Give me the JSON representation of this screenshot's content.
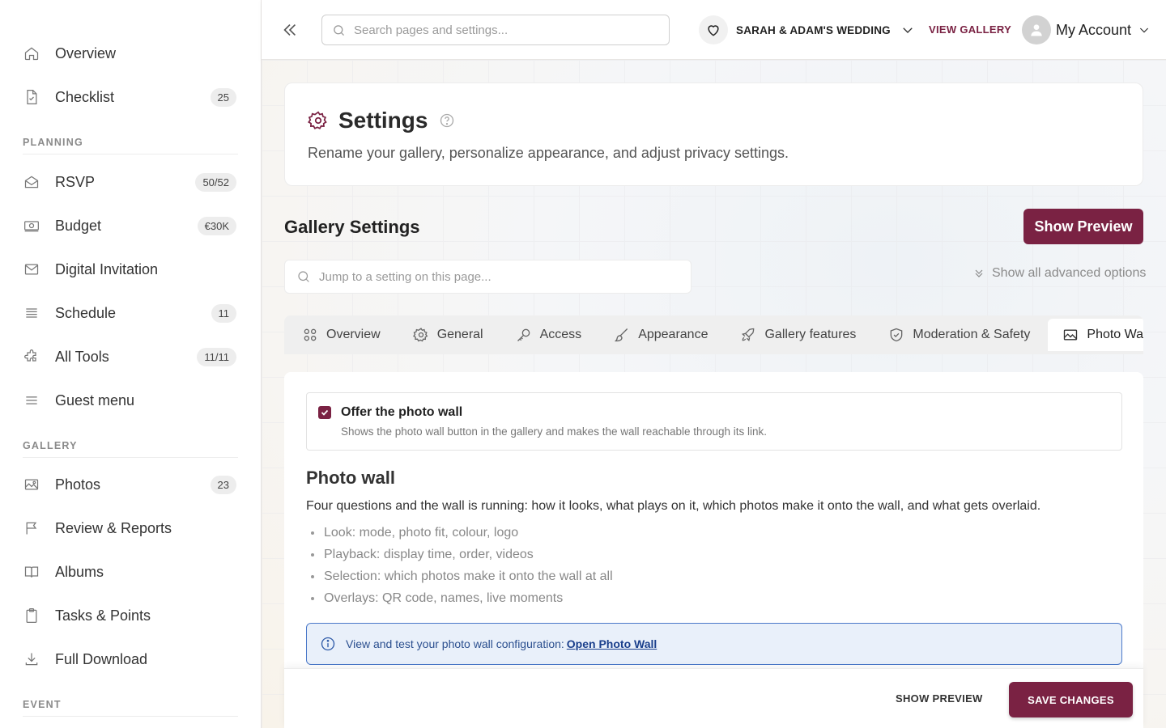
{
  "sidebar": {
    "items": [
      {
        "label": "Overview",
        "icon": "home-icon"
      },
      {
        "label": "Checklist",
        "icon": "checklist-icon",
        "badge": "25"
      },
      {
        "label": "RSVP",
        "icon": "envelope-open-icon",
        "badge": "50/52"
      },
      {
        "label": "Budget",
        "icon": "money-icon",
        "badge": "€30K"
      },
      {
        "label": "Digital Invitation",
        "icon": "mail-icon"
      },
      {
        "label": "Schedule",
        "icon": "list-icon",
        "badge": "11"
      },
      {
        "label": "All Tools",
        "icon": "puzzle-icon",
        "badge": "11/11"
      },
      {
        "label": "Guest menu",
        "icon": "menu-icon"
      },
      {
        "label": "Photos",
        "icon": "image-icon",
        "badge": "23"
      },
      {
        "label": "Review & Reports",
        "icon": "flag-icon"
      },
      {
        "label": "Albums",
        "icon": "book-icon"
      },
      {
        "label": "Tasks & Points",
        "icon": "clipboard-icon"
      },
      {
        "label": "Full Download",
        "icon": "download-icon"
      }
    ],
    "sections": {
      "planning": "PLANNING",
      "gallery": "GALLERY",
      "event": "EVENT"
    }
  },
  "topbar": {
    "search_placeholder": "Search pages and settings...",
    "event_name": "SARAH & ADAM'S WEDDING",
    "view_gallery": "VIEW GALLERY",
    "account_label": "My Account"
  },
  "header": {
    "title": "Settings",
    "subtitle": "Rename your gallery, personalize appearance, and adjust privacy settings."
  },
  "gallery_settings": {
    "title": "Gallery Settings",
    "show_preview": "Show Preview",
    "jump_placeholder": "Jump to a setting on this page...",
    "advanced_toggle": "Show all advanced options"
  },
  "tabs": [
    {
      "label": "Overview"
    },
    {
      "label": "General"
    },
    {
      "label": "Access"
    },
    {
      "label": "Appearance"
    },
    {
      "label": "Gallery features"
    },
    {
      "label": "Moderation & Safety"
    },
    {
      "label": "Photo Wall"
    }
  ],
  "content": {
    "offer_label": "Offer the photo wall",
    "offer_desc": "Shows the photo wall button in the gallery and makes the wall reachable through its link.",
    "offer_checked": true,
    "pw_title": "Photo wall",
    "pw_desc": "Four questions and the wall is running: how it looks, what plays on it, which photos make it onto the wall, and what gets overlaid.",
    "bullets": [
      "Look: mode, photo fit, colour, logo",
      "Playback: display time, order, videos",
      "Selection: which photos make it onto the wall at all",
      "Overlays: QR code, names, live moments"
    ],
    "info_text": "View and test your photo wall configuration:",
    "info_link": "Open Photo Wall"
  },
  "footer": {
    "show_preview": "SHOW PREVIEW",
    "save_changes": "SAVE CHANGES"
  },
  "colors": {
    "accent": "#7a2243",
    "info_border": "#4a78c9",
    "info_bg": "#e9f0fa"
  }
}
